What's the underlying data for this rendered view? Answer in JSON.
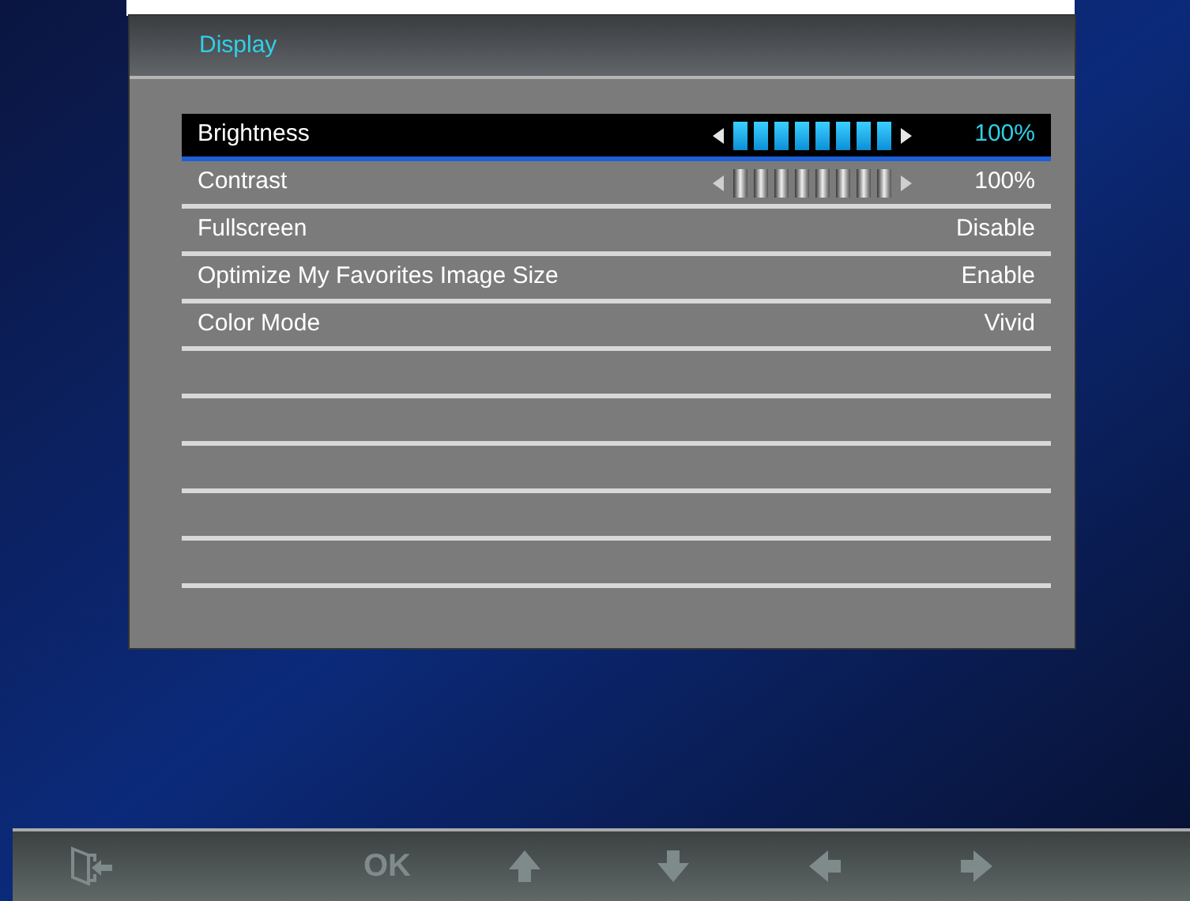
{
  "panel": {
    "title": "Display"
  },
  "rows": [
    {
      "kind": "slider",
      "label": "Brightness",
      "level": 1,
      "value": "100%",
      "selected": true
    },
    {
      "kind": "slider",
      "label": "Contrast",
      "level": 1,
      "value": "100%",
      "selected": false
    },
    {
      "kind": "option",
      "label": "Fullscreen",
      "value": "Disable",
      "selected": false
    },
    {
      "kind": "option",
      "label": "Optimize My Favorites Image Size",
      "value": "Enable",
      "selected": false
    },
    {
      "kind": "option",
      "label": "Color Mode",
      "value": "Vivid",
      "selected": false
    },
    {
      "kind": "empty",
      "selected": false
    },
    {
      "kind": "empty",
      "selected": false
    },
    {
      "kind": "empty",
      "selected": false
    },
    {
      "kind": "empty",
      "selected": false
    },
    {
      "kind": "empty",
      "selected": false
    }
  ],
  "bottom_bar": {
    "ok_label": "OK"
  }
}
